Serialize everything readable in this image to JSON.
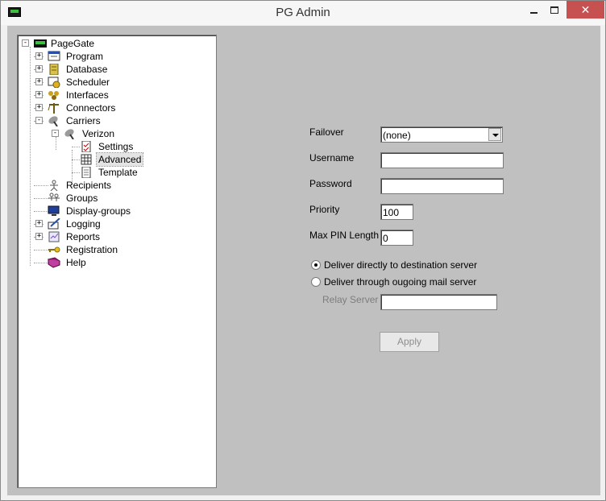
{
  "window": {
    "title": "PG Admin",
    "minimize_glyph": "",
    "close_glyph": "✕"
  },
  "tree": {
    "root": "PageGate",
    "items": [
      {
        "label": "Program",
        "icon": "program-icon"
      },
      {
        "label": "Database",
        "icon": "database-icon"
      },
      {
        "label": "Scheduler",
        "icon": "scheduler-icon"
      },
      {
        "label": "Interfaces",
        "icon": "interfaces-icon"
      },
      {
        "label": "Connectors",
        "icon": "connectors-icon"
      },
      {
        "label": "Carriers",
        "icon": "carriers-icon"
      },
      {
        "label": "Verizon",
        "icon": "satellite-icon"
      },
      {
        "label": "Settings",
        "icon": "settings-doc-icon"
      },
      {
        "label": "Advanced",
        "icon": "advanced-grid-icon"
      },
      {
        "label": "Template",
        "icon": "template-doc-icon"
      },
      {
        "label": "Recipients",
        "icon": "recipient-icon"
      },
      {
        "label": "Groups",
        "icon": "groups-icon"
      },
      {
        "label": "Display-groups",
        "icon": "monitor-icon"
      },
      {
        "label": "Logging",
        "icon": "logging-icon"
      },
      {
        "label": "Reports",
        "icon": "reports-icon"
      },
      {
        "label": "Registration",
        "icon": "key-icon"
      },
      {
        "label": "Help",
        "icon": "help-book-icon"
      }
    ],
    "selected": "Advanced"
  },
  "form": {
    "failover_label": "Failover",
    "failover_value": "(none)",
    "username_label": "Username",
    "username_value": "",
    "password_label": "Password",
    "password_value": "",
    "priority_label": "Priority",
    "priority_value": "100",
    "maxpin_label": "Max PIN Length",
    "maxpin_value": "0",
    "radio_direct": "Deliver directly to destination server",
    "radio_outgoing": "Deliver through ougoing mail server",
    "relay_label": "Relay Server",
    "relay_value": "",
    "apply_label": "Apply"
  },
  "colors": {
    "client_bg": "#c0c0c0",
    "close_button": "#c75050"
  }
}
